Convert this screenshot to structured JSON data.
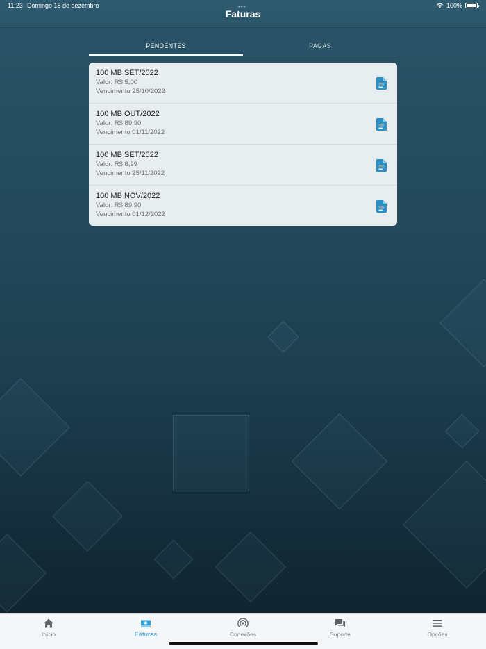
{
  "status_bar": {
    "time": "11:23",
    "date": "Domingo 18 de dezembro",
    "battery": "100%"
  },
  "header": {
    "title": "Faturas"
  },
  "tabs": [
    {
      "label": "PENDENTES",
      "active": true
    },
    {
      "label": "PAGAS",
      "active": false
    }
  ],
  "invoices": [
    {
      "title": "100 MB SET/2022",
      "valor": "Valor: R$ 5,00",
      "vencimento": "Vencimento 25/10/2022",
      "icon": "document-icon"
    },
    {
      "title": "100 MB OUT/2022",
      "valor": "Valor: R$ 89,90",
      "vencimento": "Vencimento 01/11/2022",
      "icon": "document-icon"
    },
    {
      "title": "100 MB SET/2022",
      "valor": "Valor: R$ 8,99",
      "vencimento": "Vencimento 25/11/2022",
      "icon": "document-icon"
    },
    {
      "title": "100 MB NOV/2022",
      "valor": "Valor: R$ 89,90",
      "vencimento": "Vencimento 01/12/2022",
      "icon": "document-icon"
    }
  ],
  "nav": [
    {
      "label": "Início",
      "icon": "home-icon",
      "active": false
    },
    {
      "label": "Faturas",
      "icon": "money-icon",
      "active": true
    },
    {
      "label": "Conexões",
      "icon": "signal-icon",
      "active": false
    },
    {
      "label": "Suporte",
      "icon": "chat-icon",
      "active": false
    },
    {
      "label": "Opções",
      "icon": "menu-icon",
      "active": false
    }
  ],
  "colors": {
    "accent": "#2f9fd4",
    "document_icon": "#2a8fc4",
    "background_top": "#2a5468",
    "background_bottom": "#0f222d"
  }
}
